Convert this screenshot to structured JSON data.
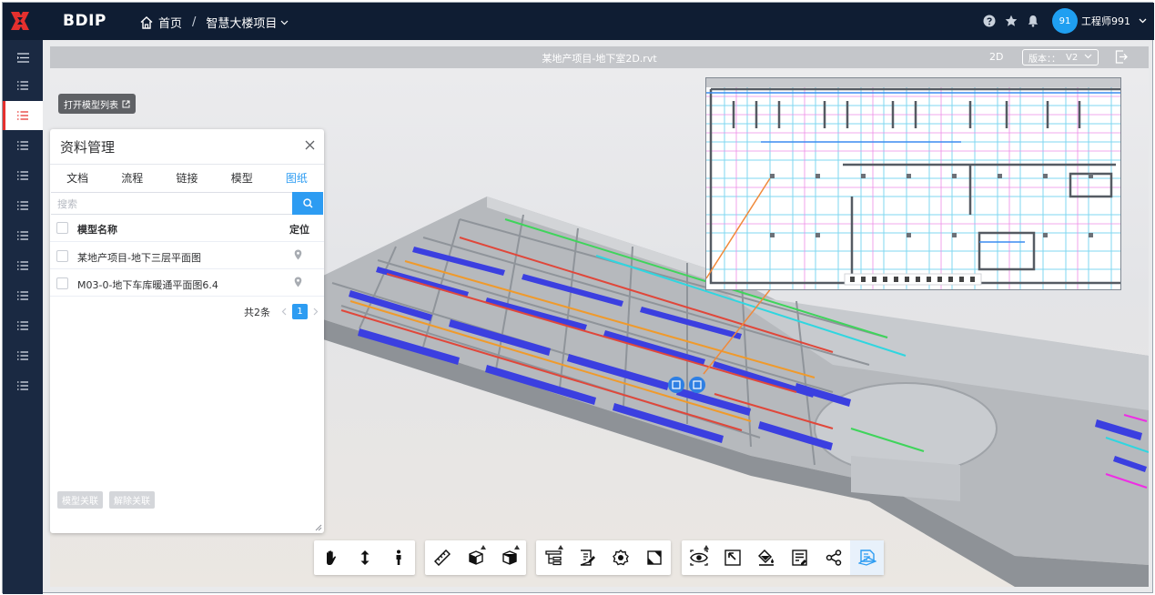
{
  "header": {
    "brand": "BDIP",
    "home_label": "首页",
    "separator": "/",
    "project_label": "智慧大楼项目",
    "avatar_text": "91",
    "user_name": "工程师991"
  },
  "colors": {
    "topbar": "#0f1d33",
    "sidenav": "#1a2942",
    "accent": "#2d9cf2",
    "active_marker": "#e5302e",
    "avatar": "#1f9ff1"
  },
  "viewer": {
    "file_name": "某地产项目-地下室2D.rvt",
    "mode": "2D",
    "version_label": "版本：：",
    "version_value": "V2",
    "open_list_label": "打开模型列表"
  },
  "panel": {
    "title": "资料管理",
    "tabs": [
      {
        "label": "文档"
      },
      {
        "label": "流程"
      },
      {
        "label": "链接"
      },
      {
        "label": "模型"
      },
      {
        "label": "图纸"
      }
    ],
    "active_tab": "图纸",
    "search_placeholder": "搜索",
    "columns": {
      "name": "模型名称",
      "locate": "定位"
    },
    "rows": [
      {
        "name": "某地产项目-地下三层平面图"
      },
      {
        "name": "M03-0-地下车库暖通平面图6.4"
      }
    ],
    "total_text": "共2条",
    "page": "1",
    "link_button": "模型关联",
    "unlink_button": "解除关联"
  },
  "sidenav": {
    "item_count": 11,
    "active_index": 2
  },
  "toolbar": {
    "groups": [
      [
        "hand-pan-icon",
        "vertical-move-icon",
        "walk-person-icon"
      ],
      [
        "measure-ruler-icon",
        "section-box-icon",
        "view-cube-icon"
      ],
      [
        "model-tree-icon",
        "properties-icon",
        "settings-gear-icon",
        "full-screen-icon"
      ],
      [
        "view-visibility-icon",
        "fit-view-icon",
        "paint-bucket-icon",
        "annotation-icon",
        "share-nodes-icon",
        "drawing-compare-icon"
      ]
    ],
    "active_button": "drawing-compare-icon"
  }
}
